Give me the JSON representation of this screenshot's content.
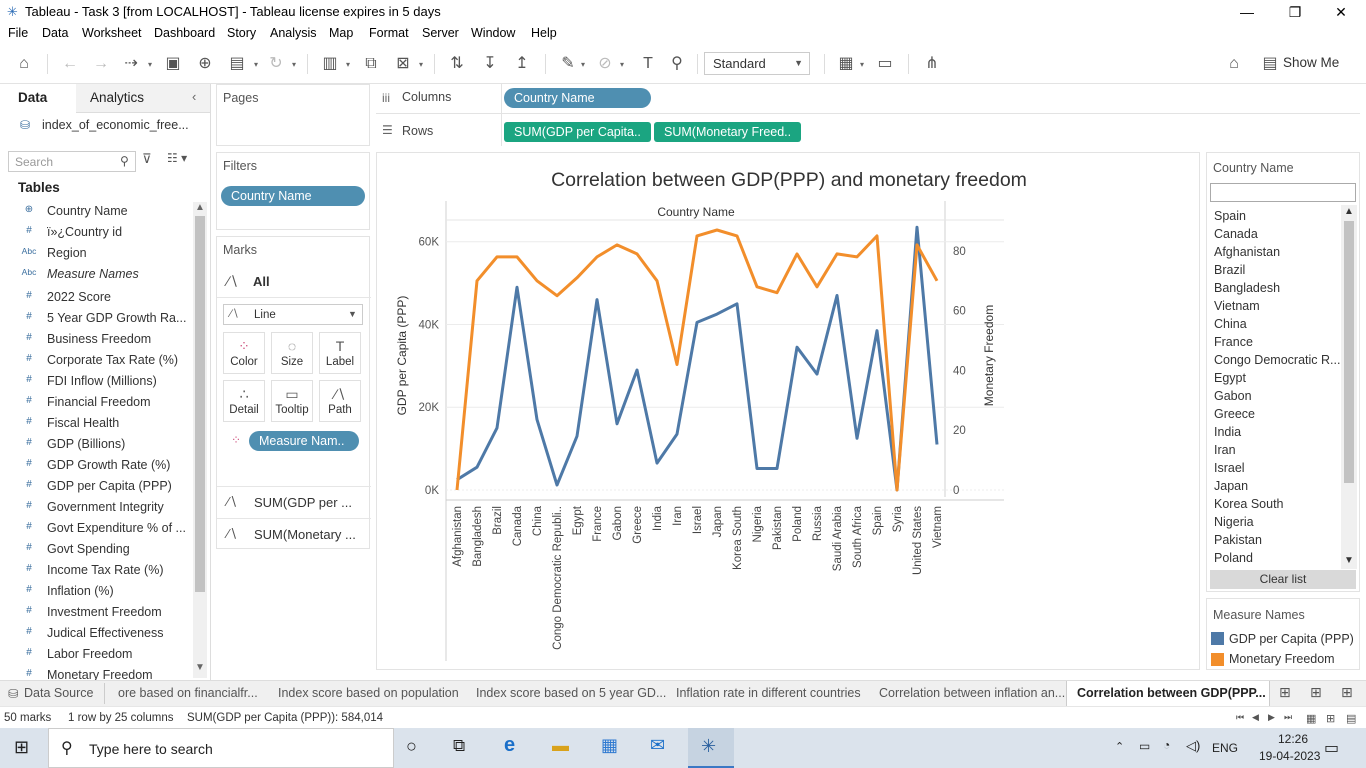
{
  "window": {
    "title": "Tableau - Task 3 [from LOCALHOST] - Tableau license expires in 5 days"
  },
  "menu": [
    "File",
    "Data",
    "Worksheet",
    "Dashboard",
    "Story",
    "Analysis",
    "Map",
    "Format",
    "Server",
    "Window",
    "Help"
  ],
  "toolbar": {
    "fit_select": "Standard",
    "show_me": "Show Me"
  },
  "data_pane": {
    "tabs": [
      "Data",
      "Analytics"
    ],
    "datasource": "index_of_economic_free...",
    "search_placeholder": "Search",
    "tables_header": "Tables",
    "dimensions": [
      {
        "icon": "globe-icon",
        "glyph": "⊕",
        "label": "Country Name"
      },
      {
        "icon": "number-icon",
        "glyph": "#",
        "label": "ï»¿Country id"
      },
      {
        "icon": "abc-icon",
        "glyph": "Abc",
        "label": "Region"
      },
      {
        "icon": "abc-icon",
        "glyph": "Abc",
        "label": "Measure Names"
      }
    ],
    "measures": [
      "2022 Score",
      "5 Year GDP Growth Ra...",
      "Business Freedom",
      "Corporate Tax Rate (%)",
      "FDI Inflow (Millions)",
      "Financial Freedom",
      "Fiscal Health",
      "GDP (Billions)",
      "GDP Growth Rate (%)",
      "GDP per Capita (PPP)",
      "Government Integrity",
      "Govt Expenditure % of ...",
      "Govt Spending",
      "Income Tax Rate (%)",
      "Inflation (%)",
      "Investment Freedom",
      "Judical Effectiveness",
      "Labor Freedom",
      "Monetary Freedom"
    ]
  },
  "shelves": {
    "pages_label": "Pages",
    "filters_label": "Filters",
    "filter_pill": "Country Name",
    "marks_label": "Marks",
    "marks_all": "All",
    "mark_type": "Line",
    "mark_buttons": [
      "Color",
      "Size",
      "Label",
      "Detail",
      "Tooltip",
      "Path"
    ],
    "color_pill": "Measure Nam..",
    "measure_cards": [
      "SUM(GDP per ...",
      "SUM(Monetary ..."
    ],
    "columns_label": "Columns",
    "columns_pill": "Country Name",
    "rows_label": "Rows",
    "rows_pills": [
      "SUM(GDP per Capita..",
      "SUM(Monetary Freed.."
    ]
  },
  "chart_data": {
    "type": "line",
    "title": "Correlation between GDP(PPP) and monetary freedom",
    "header": "Country Name",
    "ylabel_left": "GDP per Capita (PPP)",
    "ylabel_right": "Monetary Freedom",
    "ylim_left": [
      0,
      65000
    ],
    "ylim_right": [
      0,
      90
    ],
    "yticks_left": [
      "0K",
      "20K",
      "40K",
      "60K"
    ],
    "yticks_right": [
      "0",
      "20",
      "40",
      "60",
      "80"
    ],
    "categories": [
      "Afghanistan",
      "Bangladesh",
      "Brazil",
      "Canada",
      "China",
      "Congo Democratic Republi..",
      "Egypt",
      "France",
      "Gabon",
      "Greece",
      "India",
      "Iran",
      "Israel",
      "Japan",
      "Korea South",
      "Nigeria",
      "Pakistan",
      "Poland",
      "Russia",
      "Saudi Arabia",
      "South Africa",
      "Spain",
      "Syria",
      "United States",
      "Vietnam"
    ],
    "series": [
      {
        "name": "GDP per Capita (PPP)",
        "axis": "left",
        "color": "#4e79a7",
        "values": [
          2500,
          5500,
          15000,
          49000,
          17000,
          1200,
          13000,
          46000,
          16000,
          29000,
          6500,
          13500,
          40500,
          42500,
          45000,
          5200,
          5200,
          34500,
          28000,
          47000,
          12500,
          38500,
          0,
          63500,
          11000
        ]
      },
      {
        "name": "Monetary Freedom",
        "axis": "left",
        "color": "#f28e2b",
        "values": [
          0,
          70,
          78,
          78,
          70,
          65,
          71,
          78,
          82,
          79,
          70,
          42,
          85,
          87,
          85,
          68,
          66,
          79,
          68,
          79,
          78,
          85,
          0,
          82,
          70
        ]
      }
    ]
  },
  "legend": {
    "filter_title": "Country Name",
    "countries": [
      "Spain",
      "Canada",
      "Afghanistan",
      "Brazil",
      "Bangladesh",
      "Vietnam",
      "China",
      "France",
      "Congo Democratic R...",
      "Egypt",
      "Gabon",
      "Greece",
      "India",
      "Iran",
      "Israel",
      "Japan",
      "Korea South",
      "Nigeria",
      "Pakistan",
      "Poland"
    ],
    "clear_list": "Clear list",
    "measure_title": "Measure Names",
    "measure_items": [
      {
        "label": "GDP per Capita (PPP)",
        "color": "#4e79a7"
      },
      {
        "label": "Monetary Freedom",
        "color": "#f28e2b"
      }
    ]
  },
  "sheet_tabs": {
    "data_source": "Data Source",
    "tabs": [
      "ore based on financialfr...",
      "Index score based on population",
      "Index score based on 5 year GD...",
      "Inflation rate in different countries",
      "Correlation between inflation an...",
      "Correlation between GDP(PPP..."
    ]
  },
  "status": {
    "marks": "50 marks",
    "rows_cols": "1 row by 25 columns",
    "sum": "SUM(GDP per Capita (PPP)): 584,014"
  },
  "taskbar": {
    "search_placeholder": "Type here to search",
    "lang": "ENG",
    "time": "12:26",
    "date": "19-04-2023"
  }
}
